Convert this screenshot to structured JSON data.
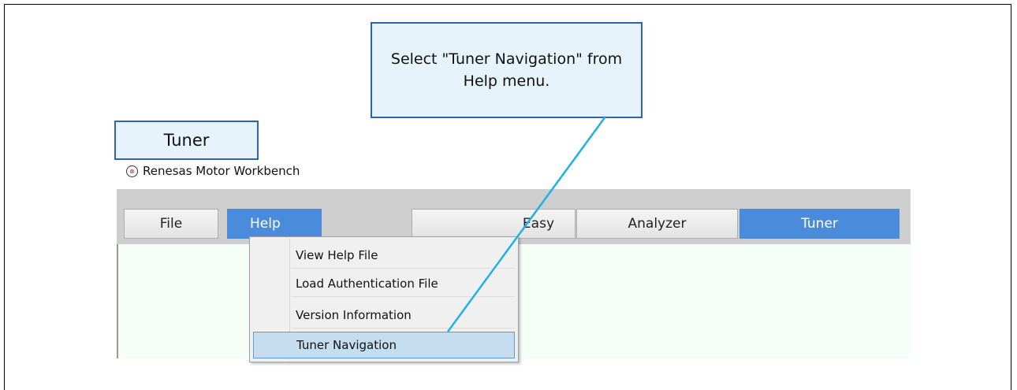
{
  "callouts": {
    "main_text": "Select \"Tuner Navigation\" from Help menu.",
    "tuner_label": "Tuner"
  },
  "app": {
    "title": "Renesas Motor Workbench",
    "logo_glyph": "⊗"
  },
  "toolbar": {
    "file_label": "File",
    "help_label": "Help",
    "easy_label": "Easy",
    "analyzer_label": "Analyzer",
    "tuner_label": "Tuner"
  },
  "help_menu": {
    "items": [
      {
        "label": "View Help File"
      },
      {
        "label": "Load Authentication File"
      },
      {
        "label": "Version Information"
      },
      {
        "label": "Tuner Navigation",
        "selected": true
      }
    ]
  },
  "colors": {
    "accent": "#4a8bdc",
    "callout_border": "#2f62b4",
    "callout_fill": "#e6f3fb",
    "pointer_line": "#1fb0e8",
    "menu_highlight": "#c5ddef"
  }
}
